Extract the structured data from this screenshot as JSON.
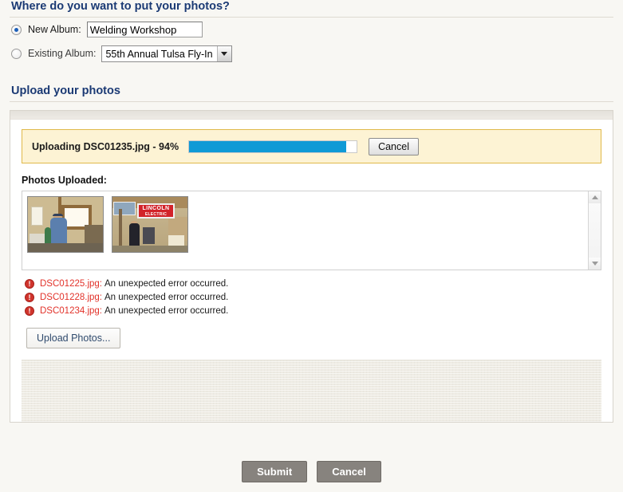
{
  "album_section": {
    "title": "Where do you want to put your photos?",
    "new_album": {
      "label": "New Album:",
      "value": "Welding Workshop",
      "placeholder": "",
      "selected": true
    },
    "existing_album": {
      "label": "Existing Album:",
      "selected_value": "55th Annual Tulsa Fly-In",
      "selected": false
    }
  },
  "upload_section": {
    "title": "Upload your photos",
    "progress": {
      "label": "Uploading DSC01235.jpg - 94%",
      "percent": 94,
      "fill_color": "#0f9ad6",
      "box_bg": "#fdf3d4",
      "box_border": "#e0b94a",
      "cancel_label": "Cancel"
    },
    "photos_uploaded": {
      "heading": "Photos Uploaded:",
      "thumbnails": [
        {
          "alt": "welding-workshop-interior-window"
        },
        {
          "alt": "lincoln-electric-banner-workshop"
        }
      ],
      "scroll_up_icon": "triangle-up-icon",
      "scroll_down_icon": "triangle-down-icon"
    },
    "errors": [
      {
        "icon": "error-icon",
        "glyph": "!",
        "file": "DSC01225.jpg:",
        "message": "An unexpected error occurred."
      },
      {
        "icon": "error-icon",
        "glyph": "!",
        "file": "DSC01228.jpg:",
        "message": "An unexpected error occurred."
      },
      {
        "icon": "error-icon",
        "glyph": "!",
        "file": "DSC01234.jpg:",
        "message": "An unexpected error occurred."
      }
    ],
    "upload_button_label": "Upload Photos..."
  },
  "footer": {
    "submit_label": "Submit",
    "cancel_label": "Cancel"
  },
  "theme": {
    "heading_color": "#1b3a74",
    "page_bg": "#f8f7f3",
    "error_color": "#e2322a",
    "accent_blue": "#0f9ad6",
    "footer_button_bg": "#87837e"
  },
  "thumb_b_text": {
    "line1": "LINCOLN",
    "line2": "ELECTRIC"
  }
}
